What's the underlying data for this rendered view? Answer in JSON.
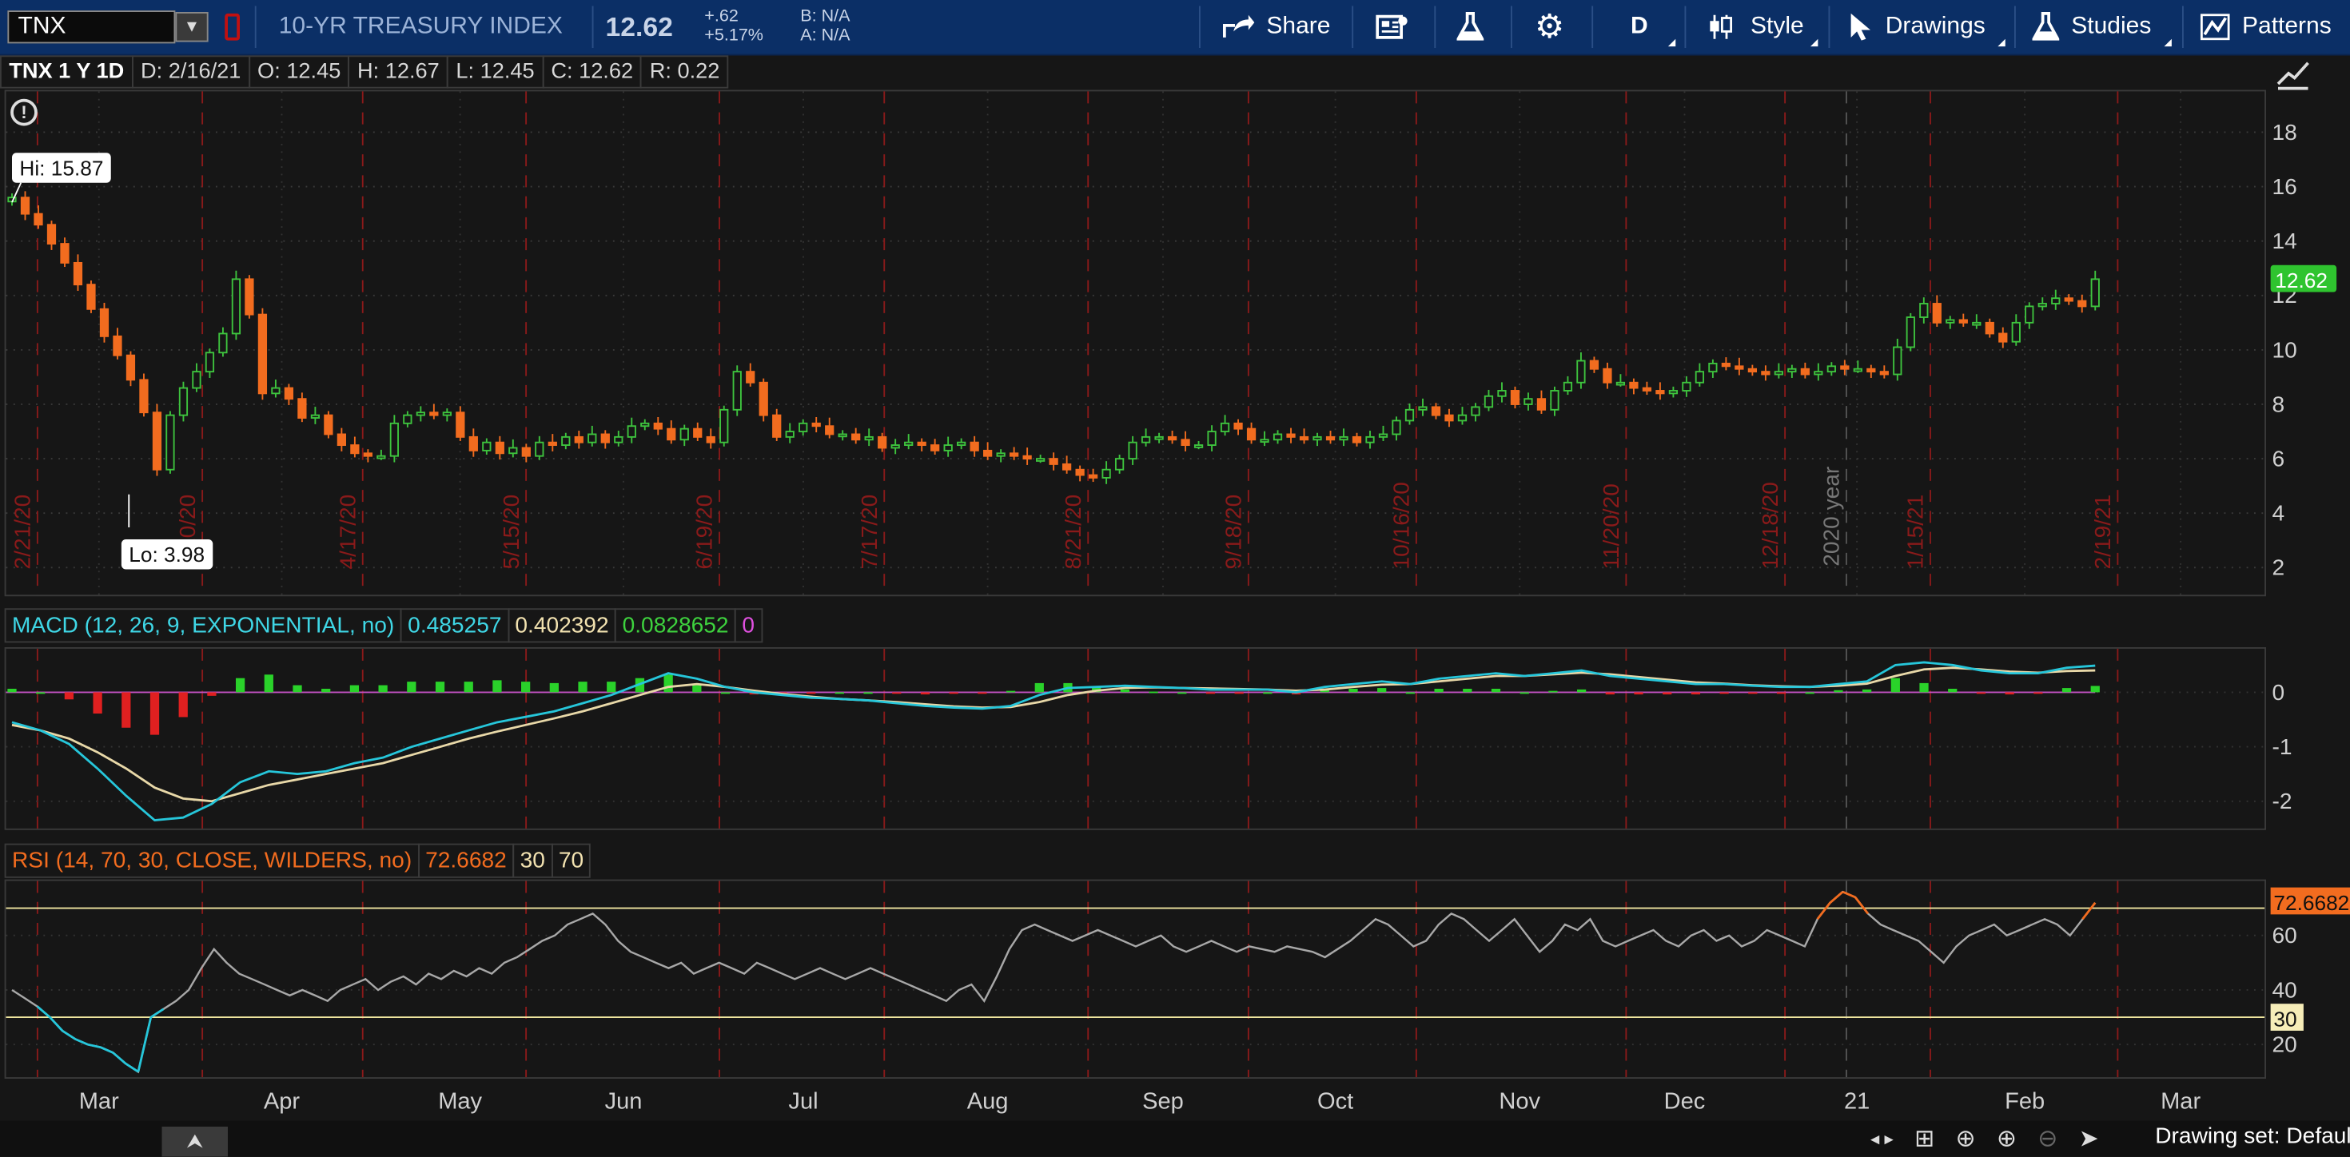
{
  "toolbar": {
    "symbol": "TNX",
    "description": "10-YR TREASURY INDEX",
    "last": "12.62",
    "change_abs": "+.62",
    "change_pct": "+5.17%",
    "bid": "B: N/A",
    "ask": "A: N/A",
    "share_label": "Share",
    "timeframe_label": "D",
    "style_label": "Style",
    "drawings_label": "Drawings",
    "studies_label": "Studies",
    "patterns_label": "Patterns"
  },
  "info_bar": {
    "title": "TNX 1 Y 1D",
    "date": "D: 2/16/21",
    "open": "O: 12.45",
    "high": "H: 12.67",
    "low": "L: 12.45",
    "close": "C: 12.62",
    "range": "R: 0.22"
  },
  "annotations": {
    "hi_label": "Hi: 15.87",
    "lo_label": "Lo: 3.98",
    "year_marker": "2020 year",
    "last_price_tag": "12.62"
  },
  "macd_header": {
    "title": "MACD (12, 26, 9, EXPONENTIAL, no)",
    "value": "0.485257",
    "avg": "0.402392",
    "diff": "0.0828652",
    "zero": "0"
  },
  "rsi_header": {
    "title": "RSI (14, 70, 30, CLOSE, WILDERS, no)",
    "value": "72.6682",
    "oversold": "30",
    "overbought": "70"
  },
  "bottom": {
    "collapse_glyph": "⮝",
    "drawing_set": "Drawing set: Default"
  },
  "colors": {
    "up": "#3ec43e",
    "down": "#f26c1f",
    "macd_line": "#26c6da",
    "macd_avg": "#e8d8a8",
    "rsi_line": "#a8a8a8",
    "rsi_band": "#f0e6a0",
    "grid_red": "#8a1a1a"
  },
  "chart_data": {
    "type": "candlestick",
    "symbol": "TNX",
    "period": "1 Y 1D",
    "price_axis": {
      "ticks": [
        2,
        4,
        6,
        8,
        10,
        12,
        14,
        16,
        18
      ],
      "range": [
        1,
        19.5
      ]
    },
    "month_labels": [
      "Mar",
      "Apr",
      "May",
      "Jun",
      "Jul",
      "Aug",
      "Sep",
      "Oct",
      "Nov",
      "Dec",
      "21",
      "Feb",
      "Mar"
    ],
    "date_markers": [
      "2/21/20",
      "3/20/20",
      "4/17/20",
      "5/15/20",
      "6/19/20",
      "7/17/20",
      "8/21/20",
      "9/18/20",
      "10/16/20",
      "11/20/20",
      "12/18/20",
      "1/15/21",
      "2/19/21"
    ],
    "high": 15.87,
    "low": 3.98,
    "last": 12.62,
    "closes": [
      15.6,
      15.0,
      14.6,
      13.9,
      13.2,
      12.4,
      11.5,
      10.5,
      9.8,
      8.9,
      7.7,
      5.6,
      7.6,
      8.6,
      9.2,
      9.9,
      10.6,
      12.6,
      11.3,
      8.4,
      8.6,
      8.2,
      7.5,
      7.6,
      6.9,
      6.5,
      6.2,
      6.1,
      6.1,
      7.3,
      7.6,
      7.7,
      7.6,
      7.7,
      6.8,
      6.3,
      6.6,
      6.2,
      6.4,
      6.1,
      6.6,
      6.5,
      6.8,
      6.6,
      6.9,
      6.6,
      6.8,
      7.2,
      7.3,
      7.1,
      6.7,
      7.1,
      6.8,
      6.6,
      7.8,
      9.2,
      8.8,
      7.6,
      6.8,
      7.0,
      7.3,
      7.2,
      6.9,
      6.9,
      6.7,
      6.8,
      6.4,
      6.5,
      6.6,
      6.5,
      6.3,
      6.5,
      6.6,
      6.3,
      6.1,
      6.2,
      6.1,
      6.0,
      6.0,
      5.8,
      5.6,
      5.4,
      5.3,
      5.6,
      6.0,
      6.6,
      6.8,
      6.8,
      6.7,
      6.5,
      6.5,
      7.0,
      7.3,
      7.1,
      6.7,
      6.7,
      6.9,
      6.8,
      6.7,
      6.8,
      6.7,
      6.8,
      6.6,
      6.8,
      6.9,
      7.4,
      7.8,
      7.9,
      7.6,
      7.4,
      7.6,
      7.9,
      8.3,
      8.5,
      8.0,
      8.2,
      7.8,
      8.5,
      8.8,
      9.6,
      9.3,
      8.8,
      8.8,
      8.6,
      8.5,
      8.4,
      8.5,
      8.8,
      9.2,
      9.5,
      9.4,
      9.3,
      9.2,
      9.1,
      9.2,
      9.3,
      9.1,
      9.2,
      9.4,
      9.3,
      9.3,
      9.2,
      9.1,
      10.1,
      11.2,
      11.7,
      11.0,
      11.1,
      11.0,
      11.0,
      10.6,
      10.3,
      11.0,
      11.6,
      11.7,
      11.9,
      11.8,
      11.6,
      12.6
    ],
    "macd": {
      "value": 0.485257,
      "avg": 0.402392,
      "diff": 0.0828652,
      "axis_ticks": [
        0,
        -1,
        -2
      ],
      "range": [
        -2.5,
        0.8
      ],
      "line": [
        -0.55,
        -0.7,
        -0.95,
        -1.4,
        -1.9,
        -2.35,
        -2.3,
        -2.05,
        -1.65,
        -1.45,
        -1.5,
        -1.45,
        -1.3,
        -1.2,
        -1.0,
        -0.85,
        -0.7,
        -0.55,
        -0.45,
        -0.35,
        -0.2,
        -0.05,
        0.15,
        0.35,
        0.25,
        0.1,
        0.0,
        -0.05,
        -0.1,
        -0.12,
        -0.15,
        -0.2,
        -0.25,
        -0.28,
        -0.3,
        -0.25,
        -0.05,
        0.08,
        0.1,
        0.12,
        0.1,
        0.08,
        0.05,
        0.05,
        0.05,
        0.0,
        0.1,
        0.15,
        0.2,
        0.15,
        0.25,
        0.3,
        0.35,
        0.3,
        0.35,
        0.4,
        0.3,
        0.25,
        0.2,
        0.15,
        0.15,
        0.12,
        0.1,
        0.1,
        0.15,
        0.2,
        0.5,
        0.55,
        0.5,
        0.4,
        0.35,
        0.35,
        0.45,
        0.49
      ],
      "signal": [
        -0.6,
        -0.7,
        -0.85,
        -1.1,
        -1.4,
        -1.75,
        -1.95,
        -2.0,
        -1.85,
        -1.7,
        -1.6,
        -1.5,
        -1.4,
        -1.3,
        -1.15,
        -1.0,
        -0.85,
        -0.72,
        -0.6,
        -0.48,
        -0.35,
        -0.2,
        -0.05,
        0.1,
        0.15,
        0.1,
        0.03,
        -0.03,
        -0.08,
        -0.12,
        -0.15,
        -0.18,
        -0.22,
        -0.26,
        -0.28,
        -0.27,
        -0.18,
        -0.05,
        0.03,
        0.08,
        0.09,
        0.08,
        0.07,
        0.06,
        0.05,
        0.03,
        0.05,
        0.1,
        0.14,
        0.15,
        0.2,
        0.25,
        0.3,
        0.3,
        0.33,
        0.36,
        0.33,
        0.28,
        0.23,
        0.18,
        0.16,
        0.13,
        0.11,
        0.1,
        0.12,
        0.16,
        0.3,
        0.42,
        0.45,
        0.42,
        0.38,
        0.36,
        0.39,
        0.4
      ]
    },
    "rsi": {
      "value": 72.6682,
      "overbought": 70,
      "oversold": 30,
      "axis_ticks": [
        20,
        40,
        60
      ],
      "range": [
        8,
        80
      ],
      "values": [
        40,
        37,
        34,
        30,
        25,
        22,
        20,
        19,
        17,
        13,
        10,
        30,
        33,
        36,
        40,
        48,
        55,
        50,
        46,
        44,
        42,
        40,
        38,
        40,
        38,
        36,
        40,
        42,
        44,
        40,
        43,
        45,
        42,
        46,
        44,
        47,
        45,
        48,
        46,
        50,
        52,
        55,
        58,
        60,
        64,
        66,
        68,
        64,
        58,
        54,
        52,
        50,
        48,
        50,
        46,
        48,
        50,
        48,
        46,
        50,
        48,
        46,
        44,
        46,
        48,
        46,
        44,
        46,
        48,
        46,
        44,
        42,
        40,
        38,
        36,
        40,
        42,
        36,
        45,
        55,
        62,
        64,
        62,
        60,
        58,
        60,
        62,
        60,
        58,
        56,
        58,
        60,
        56,
        54,
        56,
        58,
        56,
        54,
        56,
        55,
        54,
        56,
        55,
        54,
        52,
        55,
        58,
        62,
        66,
        64,
        60,
        56,
        58,
        64,
        68,
        66,
        62,
        58,
        62,
        66,
        60,
        54,
        58,
        64,
        62,
        66,
        58,
        56,
        58,
        60,
        62,
        58,
        56,
        60,
        62,
        58,
        60,
        56,
        58,
        62,
        60,
        58,
        56,
        66,
        72,
        76,
        74,
        68,
        64,
        62,
        60,
        58,
        54,
        50,
        56,
        60,
        62,
        64,
        60,
        62,
        64,
        66,
        64,
        60,
        66,
        72
      ]
    }
  }
}
